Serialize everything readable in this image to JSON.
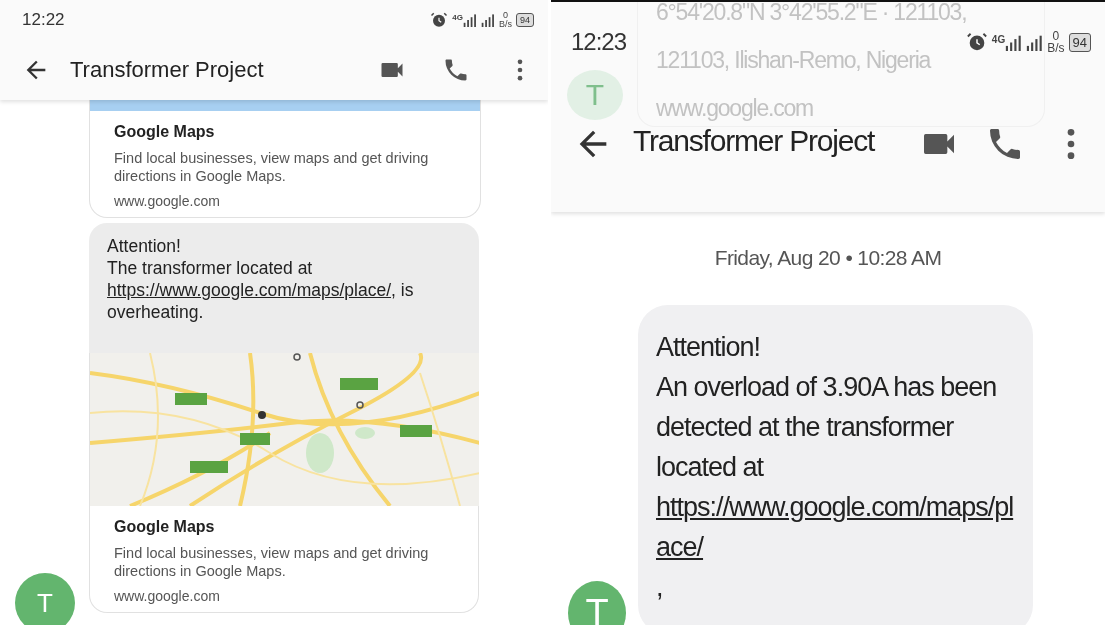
{
  "panels": [
    {
      "status_bar": {
        "time": "12:22",
        "network": "4G",
        "data_rate": "0",
        "data_unit": "B/s",
        "battery": "94"
      },
      "toolbar": {
        "title": "Transformer Project"
      },
      "messages": [
        {
          "kind": "link_preview",
          "title": "Google Maps",
          "description": "Find local businesses, view maps and get driving directions in Google Maps.",
          "domain": "www.google.com"
        },
        {
          "kind": "text_with_map",
          "parts": [
            {
              "text": "Attention!\nThe transformer located at "
            },
            {
              "link": "https://www.google.com/maps/place/"
            },
            {
              "text": ", is overheating."
            }
          ],
          "preview": {
            "title": "Google Maps",
            "description": "Find local businesses, view maps and get driving directions in Google Maps.",
            "domain": "www.google.com"
          },
          "avatar": "T"
        }
      ]
    },
    {
      "status_bar": {
        "time": "12:23",
        "network": "4G",
        "data_rate": "0",
        "data_unit": "B/s",
        "battery": "94"
      },
      "background_card": {
        "lines": [
          "6°54'20.8\"N 3°42'55.2\"E · 121103,",
          "121103, Ilishan-Remo, Nigeria",
          "www.google.com"
        ],
        "avatar": "T"
      },
      "toolbar": {
        "title": "Transformer Project"
      },
      "date_divider": "Friday, Aug 20 • 10:28 AM",
      "messages": [
        {
          "kind": "text",
          "parts": [
            {
              "text": "Attention!\nAn overload of 3.90A has been detected at the transformer located at "
            },
            {
              "link": "https://www.google.com/maps/place/"
            },
            {
              "text": ","
            }
          ],
          "avatar": "T"
        }
      ]
    }
  ]
}
